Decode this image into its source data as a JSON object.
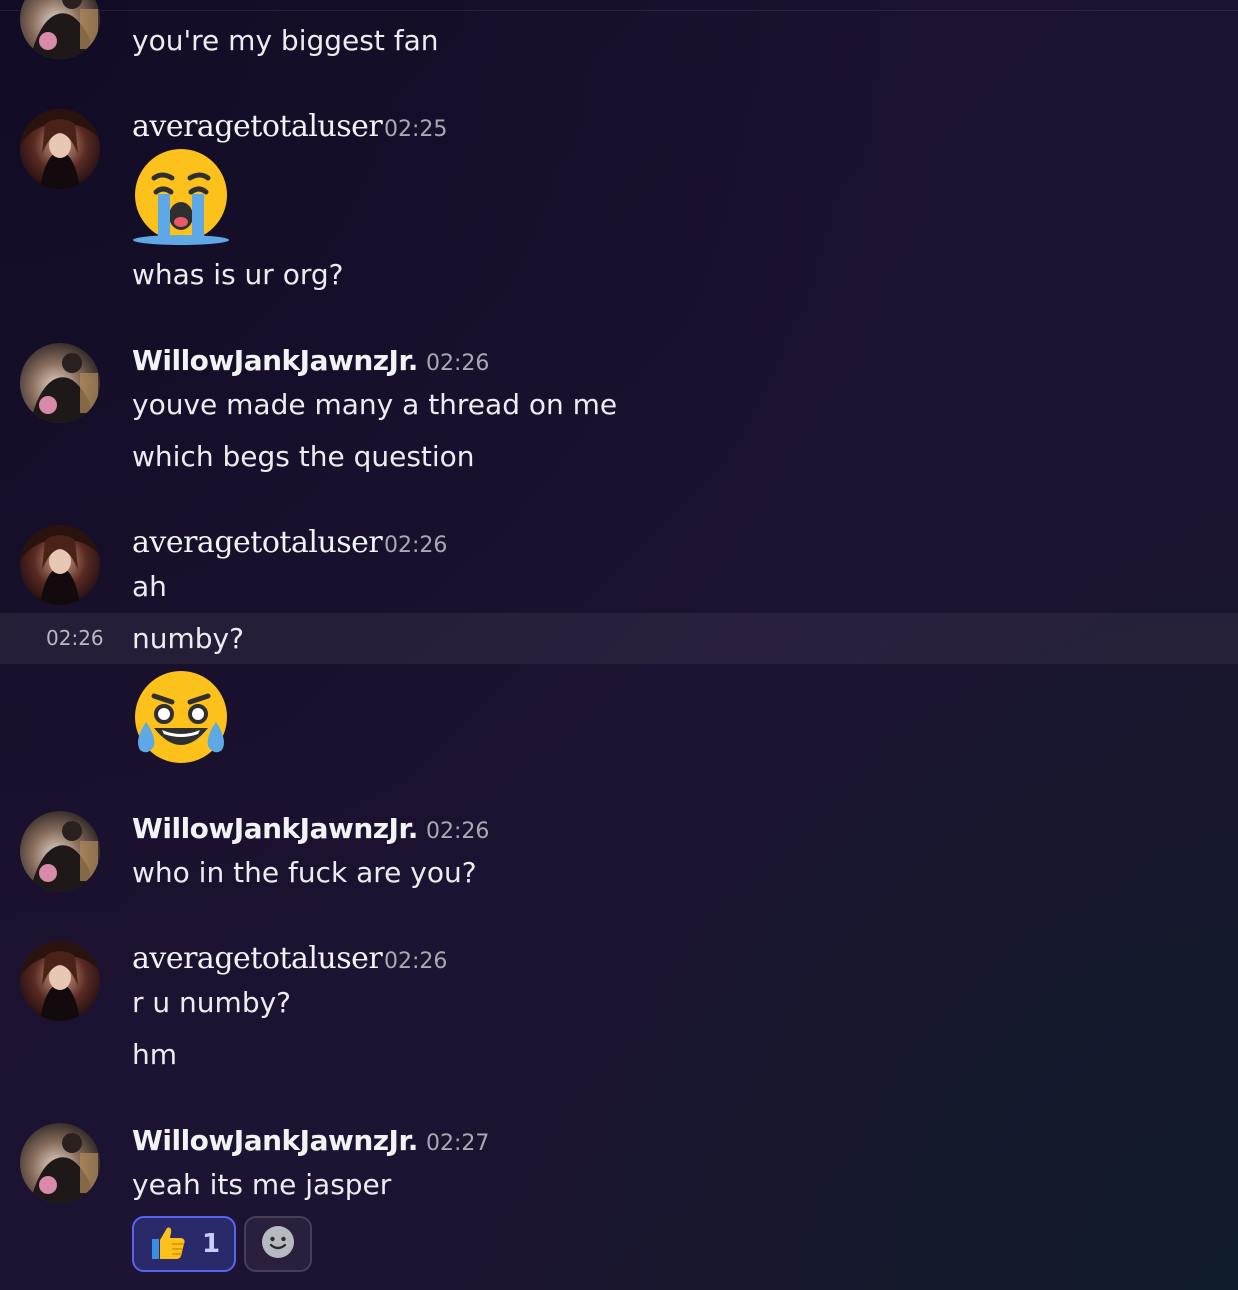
{
  "colors": {
    "background": "#1c1230",
    "text": "#ececf1",
    "timestamp": "#a9a9b5",
    "reaction_accent": "#5865f2"
  },
  "messages": [
    {
      "type": "continuation",
      "text": "you're my biggest fan"
    },
    {
      "author": "averagetotaluser",
      "time": "02:25",
      "emoji": "loudly-crying-face",
      "text": "whas is ur org?"
    },
    {
      "author": "WillowJankJawnzJr.",
      "time": "02:26",
      "lines": [
        "youve made many a thread on me",
        "which begs the question"
      ]
    },
    {
      "author": "averagetotaluser",
      "time": "02:26",
      "text": "ah",
      "hover_time": "02:26",
      "hover_text": "numby?",
      "emoji": "face-with-tears-of-joy"
    },
    {
      "author": "WillowJankJawnzJr.",
      "time": "02:26",
      "text": "who in the fuck are you?"
    },
    {
      "author": "averagetotaluser",
      "time": "02:26",
      "lines": [
        "r u numby?",
        "hm"
      ]
    },
    {
      "author": "WillowJankJawnzJr.",
      "time": "02:27",
      "text": "yeah its me jasper",
      "reactions": [
        {
          "emoji": "thumbs-up",
          "count": "1"
        },
        {
          "emoji": "add-reaction"
        }
      ]
    }
  ]
}
